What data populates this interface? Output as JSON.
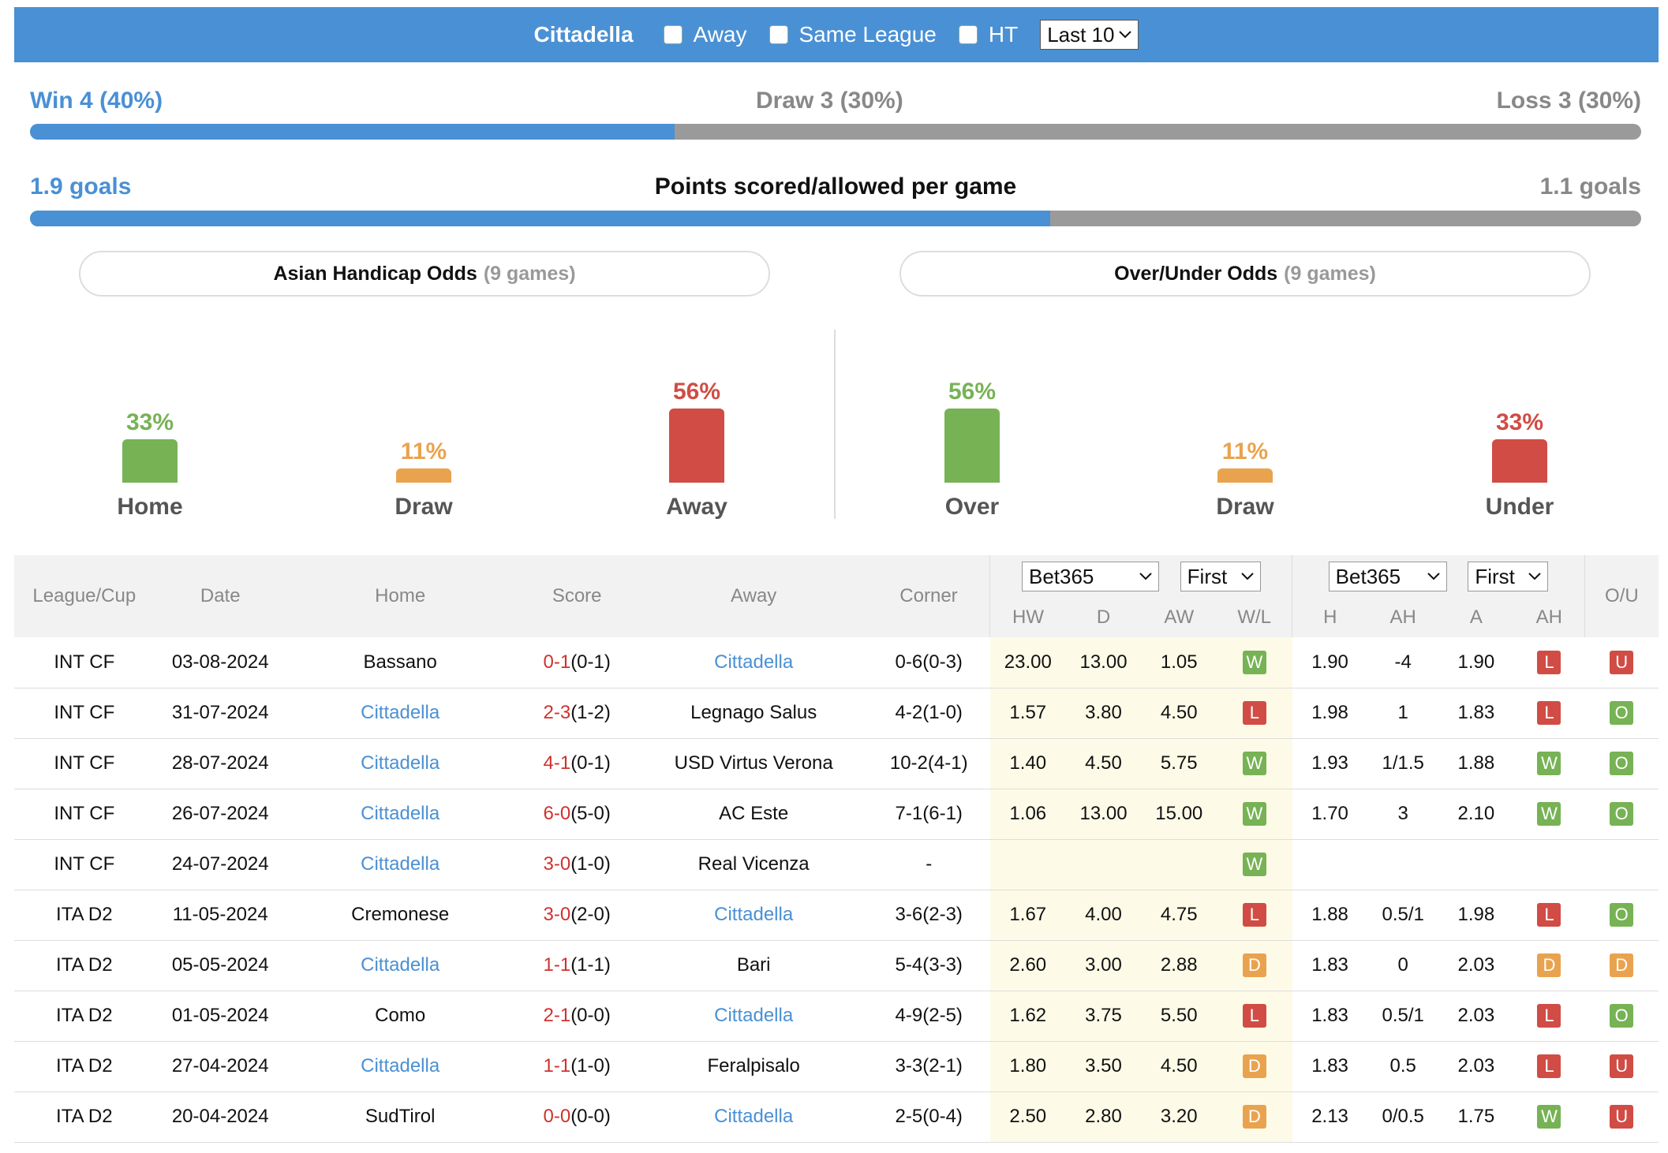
{
  "header": {
    "team": "Cittadella",
    "away_label": "Away",
    "same_league_label": "Same League",
    "ht_label": "HT",
    "last_select": "Last 10"
  },
  "record": {
    "win": "Win 4 (40%)",
    "draw": "Draw 3 (30%)",
    "loss": "Loss 3 (30%)",
    "win_fraction": 0.4
  },
  "goals": {
    "scored": "1.9 goals",
    "title": "Points scored/allowed per game",
    "allowed": "1.1 goals",
    "scored_fraction": 0.633
  },
  "ah_box": {
    "title": "Asian Handicap Odds",
    "games": "(9 games)"
  },
  "ou_box": {
    "title": "Over/Under Odds",
    "games": "(9 games)"
  },
  "ah_bars": [
    {
      "label": "Home",
      "pct_text": "33%",
      "value": 33,
      "color": "#77b255"
    },
    {
      "label": "Draw",
      "pct_text": "11%",
      "value": 11,
      "color": "#e9a34f"
    },
    {
      "label": "Away",
      "pct_text": "56%",
      "value": 56,
      "color": "#d04c45"
    }
  ],
  "ou_bars": [
    {
      "label": "Over",
      "pct_text": "56%",
      "value": 56,
      "color": "#77b255"
    },
    {
      "label": "Draw",
      "pct_text": "11%",
      "value": 11,
      "color": "#e9a34f"
    },
    {
      "label": "Under",
      "pct_text": "33%",
      "value": 33,
      "color": "#d04c45"
    }
  ],
  "table": {
    "headers": {
      "league": "League/Cup",
      "date": "Date",
      "home": "Home",
      "score": "Score",
      "away": "Away",
      "corner": "Corner",
      "ou": "O/U"
    },
    "bookmaker1": "Bet365",
    "first1": "First",
    "bookmaker2": "Bet365",
    "first2": "First",
    "subheaders": [
      "HW",
      "D",
      "AW",
      "W/L",
      "H",
      "AH",
      "A",
      "AH"
    ],
    "rows": [
      {
        "league": "INT CF",
        "date": "03-08-2024",
        "home": "Bassano",
        "home_link": false,
        "score_ft": "0-1",
        "score_ht": "(0-1)",
        "away": "Cittadella",
        "away_link": true,
        "corner": "0-6(0-3)",
        "hw": "23.00",
        "d": "13.00",
        "aw": "1.05",
        "wl": "W",
        "h": "1.90",
        "ah": "-4",
        "a": "1.90",
        "ahr": "L",
        "ou": "U"
      },
      {
        "league": "INT CF",
        "date": "31-07-2024",
        "home": "Cittadella",
        "home_link": true,
        "score_ft": "2-3",
        "score_ht": "(1-2)",
        "away": "Legnago Salus",
        "away_link": false,
        "corner": "4-2(1-0)",
        "hw": "1.57",
        "d": "3.80",
        "aw": "4.50",
        "wl": "L",
        "h": "1.98",
        "ah": "1",
        "a": "1.83",
        "ahr": "L",
        "ou": "O"
      },
      {
        "league": "INT CF",
        "date": "28-07-2024",
        "home": "Cittadella",
        "home_link": true,
        "score_ft": "4-1",
        "score_ht": "(0-1)",
        "away": "USD Virtus Verona",
        "away_link": false,
        "corner": "10-2(4-1)",
        "hw": "1.40",
        "d": "4.50",
        "aw": "5.75",
        "wl": "W",
        "h": "1.93",
        "ah": "1/1.5",
        "a": "1.88",
        "ahr": "W",
        "ou": "O"
      },
      {
        "league": "INT CF",
        "date": "26-07-2024",
        "home": "Cittadella",
        "home_link": true,
        "score_ft": "6-0",
        "score_ht": "(5-0)",
        "away": "AC Este",
        "away_link": false,
        "corner": "7-1(6-1)",
        "hw": "1.06",
        "d": "13.00",
        "aw": "15.00",
        "wl": "W",
        "h": "1.70",
        "ah": "3",
        "a": "2.10",
        "ahr": "W",
        "ou": "O"
      },
      {
        "league": "INT CF",
        "date": "24-07-2024",
        "home": "Cittadella",
        "home_link": true,
        "score_ft": "3-0",
        "score_ht": "(1-0)",
        "away": "Real Vicenza",
        "away_link": false,
        "corner": "-",
        "hw": "",
        "d": "",
        "aw": "",
        "wl": "W",
        "h": "",
        "ah": "",
        "a": "",
        "ahr": "",
        "ou": ""
      },
      {
        "league": "ITA D2",
        "date": "11-05-2024",
        "home": "Cremonese",
        "home_link": false,
        "score_ft": "3-0",
        "score_ht": "(2-0)",
        "away": "Cittadella",
        "away_link": true,
        "corner": "3-6(2-3)",
        "hw": "1.67",
        "d": "4.00",
        "aw": "4.75",
        "wl": "L",
        "h": "1.88",
        "ah": "0.5/1",
        "a": "1.98",
        "ahr": "L",
        "ou": "O"
      },
      {
        "league": "ITA D2",
        "date": "05-05-2024",
        "home": "Cittadella",
        "home_link": true,
        "score_ft": "1-1",
        "score_ht": "(1-1)",
        "away": "Bari",
        "away_link": false,
        "corner": "5-4(3-3)",
        "hw": "2.60",
        "d": "3.00",
        "aw": "2.88",
        "wl": "D",
        "h": "1.83",
        "ah": "0",
        "a": "2.03",
        "ahr": "D",
        "ou": "D"
      },
      {
        "league": "ITA D2",
        "date": "01-05-2024",
        "home": "Como",
        "home_link": false,
        "score_ft": "2-1",
        "score_ht": "(0-0)",
        "away": "Cittadella",
        "away_link": true,
        "corner": "4-9(2-5)",
        "hw": "1.62",
        "d": "3.75",
        "aw": "5.50",
        "wl": "L",
        "h": "1.83",
        "ah": "0.5/1",
        "a": "2.03",
        "ahr": "L",
        "ou": "O"
      },
      {
        "league": "ITA D2",
        "date": "27-04-2024",
        "home": "Cittadella",
        "home_link": true,
        "score_ft": "1-1",
        "score_ht": "(1-0)",
        "away": "Feralpisalo",
        "away_link": false,
        "corner": "3-3(2-1)",
        "hw": "1.80",
        "d": "3.50",
        "aw": "4.50",
        "wl": "D",
        "h": "1.83",
        "ah": "0.5",
        "a": "2.03",
        "ahr": "L",
        "ou": "U"
      },
      {
        "league": "ITA D2",
        "date": "20-04-2024",
        "home": "SudTirol",
        "home_link": false,
        "score_ft": "0-0",
        "score_ht": "(0-0)",
        "away": "Cittadella",
        "away_link": true,
        "corner": "2-5(0-4)",
        "hw": "2.50",
        "d": "2.80",
        "aw": "3.20",
        "wl": "D",
        "h": "2.13",
        "ah": "0/0.5",
        "a": "1.75",
        "ahr": "W",
        "ou": "U"
      }
    ]
  }
}
